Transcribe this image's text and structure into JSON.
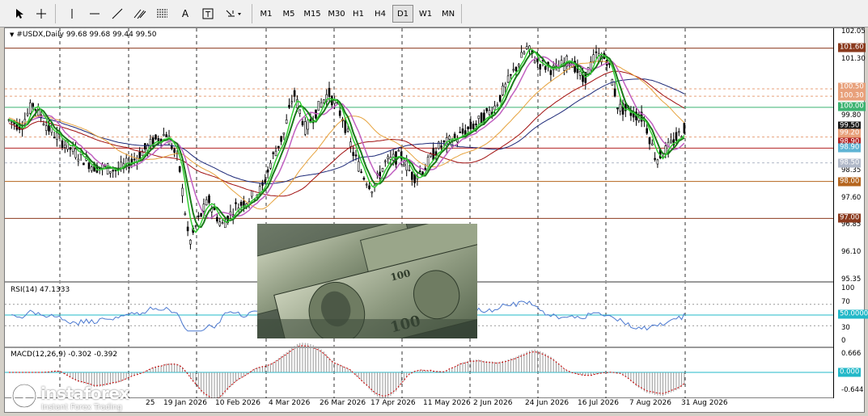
{
  "toolbar": {
    "tools": [
      {
        "name": "cursor-icon",
        "glyph": "↖"
      },
      {
        "name": "crosshair-icon",
        "glyph": "+"
      },
      {
        "name": "vertical-line-icon",
        "glyph": "|"
      },
      {
        "name": "horizontal-line-icon",
        "glyph": "—"
      },
      {
        "name": "trendline-icon",
        "glyph": "/"
      },
      {
        "name": "channel-icon",
        "glyph": "⫽"
      },
      {
        "name": "fibonacci-icon",
        "glyph": "F"
      },
      {
        "name": "text-icon",
        "glyph": "A"
      },
      {
        "name": "text-label-icon",
        "glyph": "T"
      },
      {
        "name": "arrows-icon",
        "glyph": "⇲"
      }
    ],
    "timeframes": [
      "M1",
      "M5",
      "M15",
      "M30",
      "H1",
      "H4",
      "D1",
      "W1",
      "MN"
    ],
    "active_timeframe": "D1"
  },
  "chart": {
    "title": "#USDX,Daily  99.68 99.68 99.44 99.50",
    "price_ticks": [
      "102.05",
      "101.30",
      "99.80",
      "98.35",
      "97.60",
      "96.85",
      "96.10",
      "95.35"
    ],
    "level_labels": [
      {
        "text": "101.60",
        "color": "#8b3a1e"
      },
      {
        "text": "100.50",
        "color": "#e8a07a"
      },
      {
        "text": "100.30",
        "color": "#e8a07a"
      },
      {
        "text": "100.00",
        "color": "#3cb371"
      },
      {
        "text": "99.50",
        "color": "#1a1a1a"
      },
      {
        "text": "99.20",
        "color": "#e8a07a"
      },
      {
        "text": "98.90",
        "color": "#b22222"
      },
      {
        "text": "98.90",
        "color": "#5fb4d4"
      },
      {
        "text": "98.50",
        "color": "#b0b8c8"
      },
      {
        "text": "98.00",
        "color": "#b5651d"
      },
      {
        "text": "97.00",
        "color": "#8b3a1e"
      }
    ],
    "date_ticks": [
      "25",
      "19 Jan 2026",
      "10 Feb 2026",
      "4 Mar 2026",
      "26 Mar 2026",
      "17 Apr 2026",
      "11 May 2026",
      "2 Jun 2026",
      "24 Jun 2026",
      "16 Jul 2026",
      "7 Aug 2026",
      "31 Aug 2026"
    ]
  },
  "rsi": {
    "title": "RSI(14) 47.1333",
    "ticks": [
      "100",
      "70",
      "30",
      "0"
    ],
    "level_label": "50.0000"
  },
  "macd": {
    "title": "MACD(12,26,9) -0.302 -0.392",
    "ticks": [
      "0.666",
      "-0.644"
    ],
    "level_label": "0.000"
  },
  "watermark": {
    "brand": "instaforex",
    "tagline": "Instant Forex Trading"
  },
  "colors": {
    "candle": "#000000",
    "ma_green_dark": "#1a7a1a",
    "ma_green_light": "#33cc33",
    "ma_violet": "#c060c0",
    "ma_orange": "#e6a23c",
    "ma_navy": "#1e2a78",
    "ma_red": "#a01010",
    "rsi_line": "#4a78d0",
    "level_cyan": "#22b8c8",
    "macd_signal": "#cc0000"
  }
}
